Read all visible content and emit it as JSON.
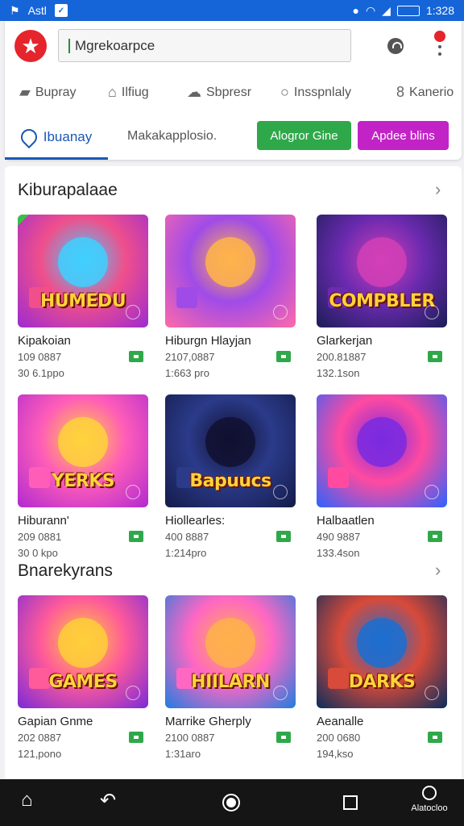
{
  "status_bar": {
    "left_text": "Astl",
    "left_square": "✓",
    "time": "1:328"
  },
  "header": {
    "search_value": "Mgrekoarpce",
    "categories": [
      {
        "label": "Bupray",
        "icon": "bag-icon"
      },
      {
        "label": "Ilfiug",
        "icon": "book-icon"
      },
      {
        "label": "Sbpresr",
        "icon": "cloud-icon"
      },
      {
        "label": "Insspnlaly",
        "icon": "chat-icon"
      },
      {
        "label": "Kanerio",
        "icon": "link-icon"
      }
    ],
    "tab_active": "Ibuanay",
    "tab_secondary": "Makakapplosio.",
    "button_green": "Alogror Gine",
    "button_purple": "Apdee blins"
  },
  "sections": [
    {
      "title": "Kiburapalaae",
      "cards": [
        {
          "name": "Kipakoian",
          "meta1": "109 0887",
          "meta2": "30 6.1ppo",
          "art_text": "HUMEDU",
          "colors": [
            "#9b2bd1",
            "#f04f8b",
            "#3fd0ff"
          ]
        },
        {
          "name": "Hiburgn Hlayjan",
          "meta1": "2107,0887",
          "meta2": "1:663 pro",
          "art_text": "",
          "colors": [
            "#ff6aa8",
            "#a04be8",
            "#ffb44a"
          ]
        },
        {
          "name": "Glarkerjan",
          "meta1": "200.81887",
          "meta2": "132.1son",
          "art_text": "COMPBLER",
          "colors": [
            "#1b1d56",
            "#6b2ab0",
            "#d23fb6"
          ]
        }
      ]
    },
    {
      "title": "",
      "cards": [
        {
          "name": "Hiburann'",
          "meta1": "209 0881",
          "meta2": "30 0 kpo",
          "art_text": "YERKS",
          "colors": [
            "#b02ad0",
            "#ff5db8",
            "#ffd23c"
          ]
        },
        {
          "name": "Hiollearles:",
          "meta1": "400 8887",
          "meta2": "1:214pro",
          "art_text": "Bapuucs",
          "colors": [
            "#141b4a",
            "#2b3b8a",
            "#101030"
          ]
        },
        {
          "name": "Halbaatlen",
          "meta1": "490 9887",
          "meta2": "133.4son",
          "art_text": "",
          "colors": [
            "#2a63ff",
            "#ff4aa0",
            "#7a2ae0"
          ]
        }
      ]
    },
    {
      "title": "Bnarekyrans",
      "cards": [
        {
          "name": "Gapian Gnme",
          "meta1": "202 0887",
          "meta2": "121,pono",
          "art_text": "GAMES",
          "colors": [
            "#7a2ad8",
            "#ff5a9a",
            "#ffcf3a"
          ]
        },
        {
          "name": "Marrike Gherply",
          "meta1": "2100 0887",
          "meta2": "1:31aro",
          "art_text": "HIILARN",
          "colors": [
            "#1e7de0",
            "#ff67c3",
            "#ffb14a"
          ]
        },
        {
          "name": "Aeanalle",
          "meta1": "200 0680",
          "meta2": "194,kso",
          "art_text": "DARKS",
          "colors": [
            "#0b2d5c",
            "#d84a3a",
            "#1b6fd1"
          ]
        }
      ]
    }
  ],
  "navbar": {
    "account_label": "Alatocloo"
  }
}
